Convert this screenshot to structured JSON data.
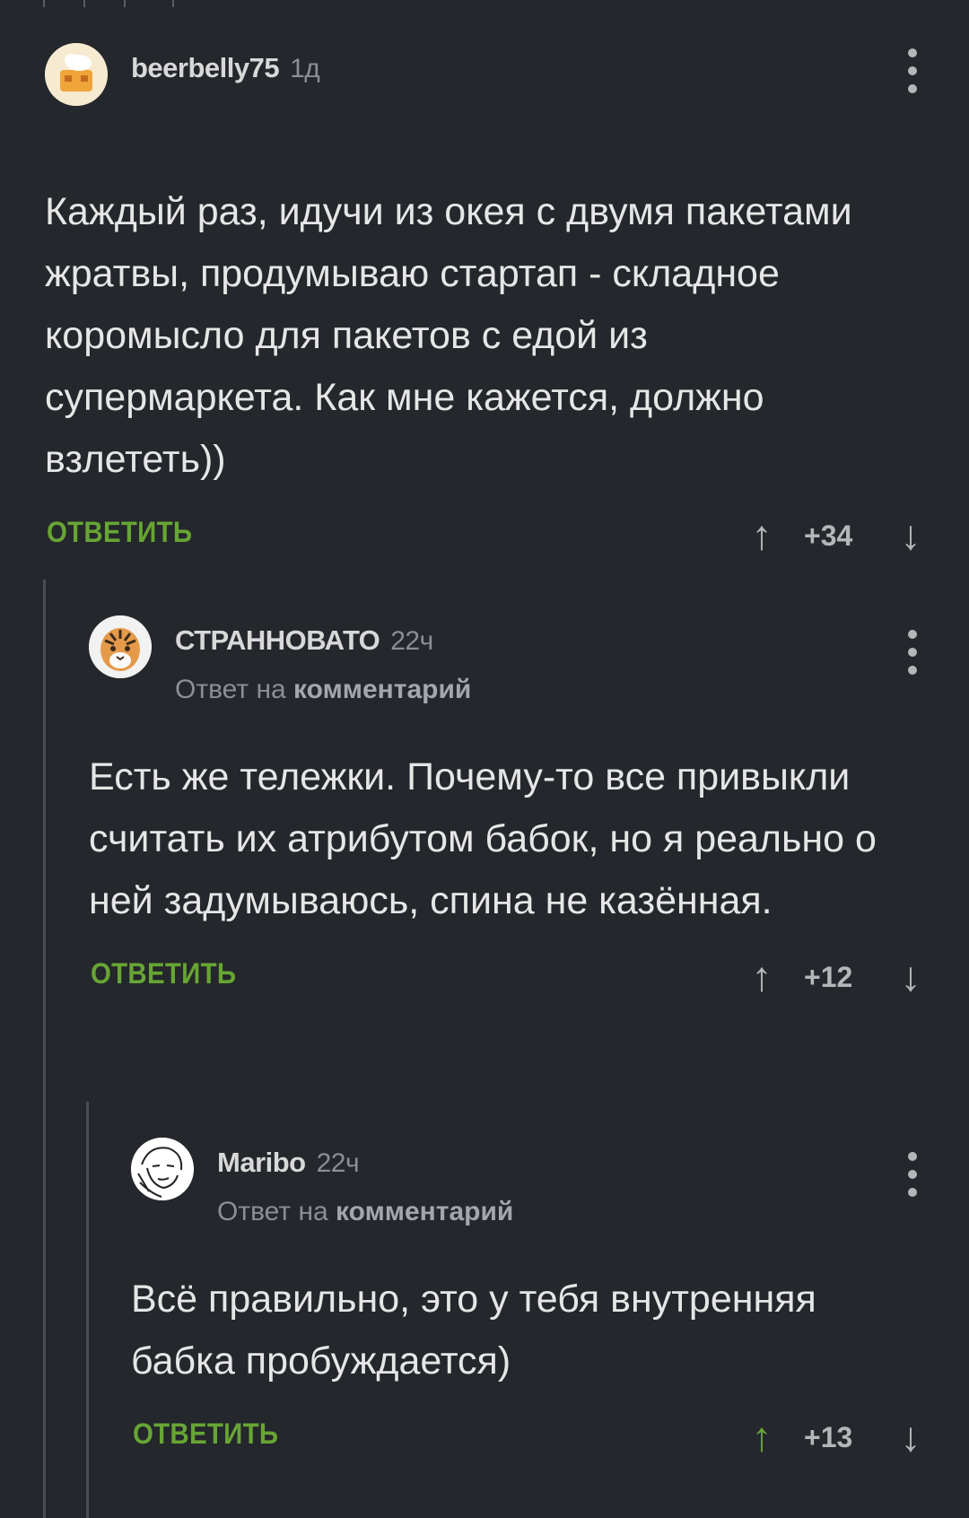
{
  "comments": [
    {
      "username": "beerbelly75",
      "time": "1д",
      "text": "Каждый раз, идучи из окея с двумя пакетами жратвы, продумываю стартап - складное коромысло для пакетов с едой из супермаркета. Как мне кажется, должно взлететь))",
      "reply_label": "ОТВЕТИТЬ",
      "score": "+34"
    },
    {
      "username": "СТРАННОВАТО",
      "time": "22ч",
      "reply_prefix": "Ответ на",
      "reply_target": "комментарий",
      "text": "Есть же тележки. Почему-то все привыкли считать их атрибутом бабок, но я реально о ней задумываюсь, спина не казённая.",
      "reply_label": "ОТВЕТИТЬ",
      "score": "+12"
    },
    {
      "username": "Maribo",
      "time": "22ч",
      "reply_prefix": "Ответ на",
      "reply_target": "комментарий",
      "text": "Всё правильно, это у тебя внутренняя бабка пробуждается)",
      "reply_label": "ОТВЕТИТЬ",
      "score": "+13",
      "upvoted": true
    }
  ],
  "icons": {
    "upvote": "arrow-up-icon",
    "downvote": "arrow-down-icon",
    "more": "more-vertical-icon"
  },
  "colors": {
    "background": "#24272b",
    "accent_green": "#67a534",
    "muted": "#8b8e93"
  }
}
